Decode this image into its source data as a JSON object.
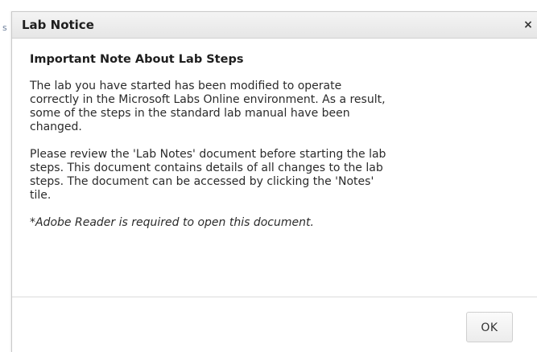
{
  "background": {
    "fragment": "s"
  },
  "dialog": {
    "title": "Lab Notice",
    "close_icon": "×",
    "heading": "Important Note About Lab Steps",
    "paragraph1": "The lab you have started has been modified to operate\ncorrectly in the Microsoft Labs Online environment. As a result,\nsome of the steps in the standard lab manual have been\nchanged.",
    "paragraph2": "Please review the 'Lab Notes' document before starting the lab\nsteps. This document contains details of all changes to the lab\nsteps. The document can be accessed by clicking the 'Notes'\ntile.",
    "note": "*Adobe Reader is required to open this document.",
    "ok_label": "OK"
  }
}
